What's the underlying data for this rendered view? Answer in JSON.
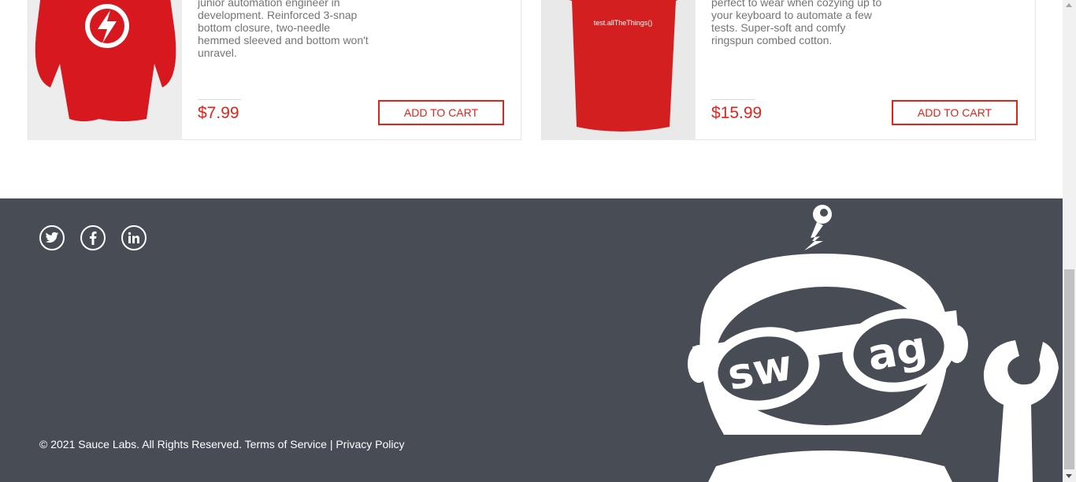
{
  "products": [
    {
      "description": "junior automation engineer in development. Reinforced 3-snap bottom closure, two-needle hemmed sleeved and bottom won't unravel.",
      "price": "$7.99",
      "button": "ADD TO CART"
    },
    {
      "description": "perfect to wear when cozying up to your keyboard to automate a few tests. Super-soft and comfy ringspun combed cotton.",
      "price": "$15.99",
      "button": "ADD TO CART",
      "shirt_print": "test.allTheThings()"
    }
  ],
  "footer": {
    "social": [
      "twitter-icon",
      "facebook-icon",
      "linkedin-icon"
    ],
    "copyright": "© 2021 Sauce Labs. All Rights Reserved.",
    "terms": "Terms of Service",
    "divider": "|",
    "privacy": "Privacy Policy",
    "mascot_text": [
      "sw",
      "ag"
    ]
  },
  "colors": {
    "accent": "#e2231a",
    "footer_bg": "#474c55",
    "text_muted": "#747474"
  }
}
